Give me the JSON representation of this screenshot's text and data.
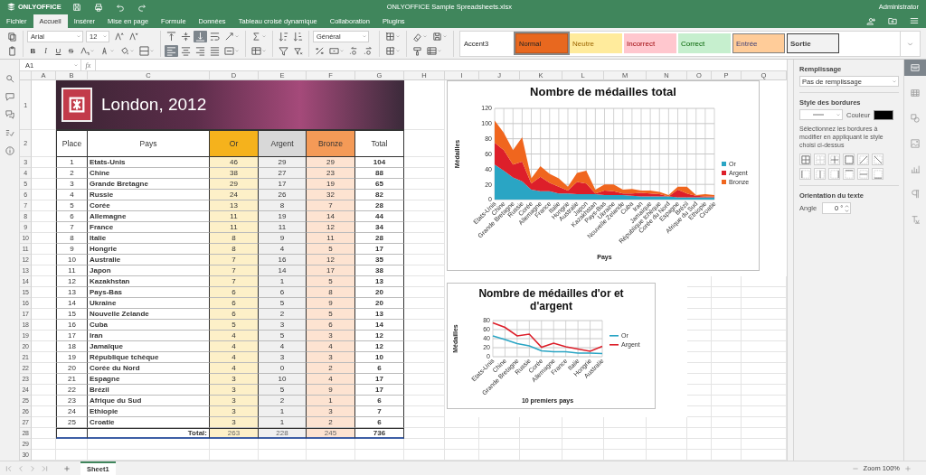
{
  "app": {
    "logo": "ONLYOFFICE",
    "title": "ONLYOFFICE Sample Spreadsheets.xlsx",
    "user": "Administrator"
  },
  "tabs": [
    {
      "label": "Fichier",
      "selected": false
    },
    {
      "label": "Accueil",
      "selected": true
    },
    {
      "label": "Insérer",
      "selected": false
    },
    {
      "label": "Mise en page",
      "selected": false
    },
    {
      "label": "Formule",
      "selected": false
    },
    {
      "label": "Données",
      "selected": false
    },
    {
      "label": "Tableau croisé dynamique",
      "selected": false
    },
    {
      "label": "Collaboration",
      "selected": false
    },
    {
      "label": "Plugins",
      "selected": false
    }
  ],
  "toolbar": {
    "font_name": "Arial",
    "font_size": "12",
    "style_buttons": [
      "B",
      "I",
      "U",
      "S"
    ],
    "number_format": "Général",
    "styles": [
      {
        "label": "Accent3",
        "kind": "accent",
        "selected": false
      },
      {
        "label": "Normal",
        "kind": "normal",
        "selected": true
      },
      {
        "label": "Neutre",
        "kind": "neutral",
        "selected": false
      },
      {
        "label": "Incorrect",
        "kind": "bad",
        "selected": false
      },
      {
        "label": "Correct",
        "kind": "good",
        "selected": false
      },
      {
        "label": "Entrée",
        "kind": "input",
        "selected": false
      },
      {
        "label": "Sortie",
        "kind": "output",
        "selected": false
      }
    ]
  },
  "formula_bar": {
    "cell_ref": "A1",
    "fx": "fx"
  },
  "sheet": {
    "columns": [
      "A",
      "B",
      "C",
      "D",
      "E",
      "F",
      "G",
      "H",
      "I",
      "J",
      "K",
      "L",
      "M",
      "N",
      "O",
      "P",
      "Q"
    ],
    "rows": [
      "1",
      "2",
      "3",
      "4",
      "5",
      "6",
      "7",
      "8",
      "9",
      "10",
      "11",
      "12",
      "13",
      "14",
      "15",
      "16",
      "17",
      "18",
      "19",
      "20",
      "21",
      "22",
      "23",
      "24",
      "25",
      "26",
      "27",
      "28",
      "29",
      "30"
    ],
    "banner_title": "London, 2012",
    "table": {
      "columns": [
        "Place",
        "Pays",
        "Or",
        "Argent",
        "Bronze",
        "Total"
      ],
      "rows": [
        [
          "1",
          "Etats-Unis",
          "46",
          "29",
          "29",
          "104"
        ],
        [
          "2",
          "Chine",
          "38",
          "27",
          "23",
          "88"
        ],
        [
          "3",
          "Grande Bretagne",
          "29",
          "17",
          "19",
          "65"
        ],
        [
          "4",
          "Russie",
          "24",
          "26",
          "32",
          "82"
        ],
        [
          "5",
          "Corée",
          "13",
          "8",
          "7",
          "28"
        ],
        [
          "6",
          "Allemagne",
          "11",
          "19",
          "14",
          "44"
        ],
        [
          "7",
          "France",
          "11",
          "11",
          "12",
          "34"
        ],
        [
          "8",
          "Italie",
          "8",
          "9",
          "11",
          "28"
        ],
        [
          "9",
          "Hongrie",
          "8",
          "4",
          "5",
          "17"
        ],
        [
          "10",
          "Australie",
          "7",
          "16",
          "12",
          "35"
        ],
        [
          "11",
          "Japon",
          "7",
          "14",
          "17",
          "38"
        ],
        [
          "12",
          "Kazakhstan",
          "7",
          "1",
          "5",
          "13"
        ],
        [
          "13",
          "Pays-Bas",
          "6",
          "6",
          "8",
          "20"
        ],
        [
          "14",
          "Ukraine",
          "6",
          "5",
          "9",
          "20"
        ],
        [
          "15",
          "Nouvelle Zelande",
          "6",
          "2",
          "5",
          "13"
        ],
        [
          "16",
          "Cuba",
          "5",
          "3",
          "6",
          "14"
        ],
        [
          "17",
          "Iran",
          "4",
          "5",
          "3",
          "12"
        ],
        [
          "18",
          "Jamaïque",
          "4",
          "4",
          "4",
          "12"
        ],
        [
          "19",
          "République tchèque",
          "4",
          "3",
          "3",
          "10"
        ],
        [
          "20",
          "Corée du Nord",
          "4",
          "0",
          "2",
          "6"
        ],
        [
          "21",
          "Espagne",
          "3",
          "10",
          "4",
          "17"
        ],
        [
          "22",
          "Brézil",
          "3",
          "5",
          "9",
          "17"
        ],
        [
          "23",
          "Afrique du Sud",
          "3",
          "2",
          "1",
          "6"
        ],
        [
          "24",
          "Ethiopie",
          "3",
          "1",
          "3",
          "7"
        ],
        [
          "25",
          "Croatie",
          "3",
          "1",
          "2",
          "6"
        ]
      ],
      "total_label": "Total:",
      "totals": [
        "263",
        "228",
        "245",
        "736"
      ]
    }
  },
  "charts": [
    {
      "chart_data": {
        "type": "area",
        "stacked": true,
        "title": "Nombre de médailles total",
        "xlabel": "Pays",
        "ylabel": "Médailles",
        "categories": [
          "Etats-Unis",
          "Chine",
          "Grande Bretagne",
          "Russie",
          "Corée",
          "Allemagne",
          "France",
          "Italie",
          "Hongrie",
          "Australie",
          "Japon",
          "Kazakhstan",
          "Pays-Bas",
          "Ukraine",
          "Nouvelle Zelande",
          "Cuba",
          "Iran",
          "Jamaïque",
          "République tchèque",
          "Corée du Nord",
          "Espagne",
          "Brézil",
          "Afrique du Sud",
          "Ethiopie",
          "Croatie"
        ],
        "series": [
          {
            "name": "Or",
            "color": "#2aa5c4",
            "values": [
              46,
              38,
              29,
              24,
              13,
              11,
              11,
              8,
              8,
              7,
              7,
              7,
              6,
              6,
              6,
              5,
              4,
              4,
              4,
              4,
              3,
              3,
              3,
              3,
              3
            ]
          },
          {
            "name": "Argent",
            "color": "#dd1f2a",
            "values": [
              29,
              27,
              17,
              26,
              8,
              19,
              11,
              9,
              4,
              16,
              14,
              1,
              6,
              5,
              2,
              3,
              5,
              4,
              3,
              0,
              10,
              5,
              2,
              1,
              1
            ]
          },
          {
            "name": "Bronze",
            "color": "#f0661e",
            "values": [
              29,
              23,
              19,
              32,
              7,
              14,
              12,
              11,
              5,
              12,
              17,
              5,
              8,
              9,
              5,
              6,
              3,
              4,
              3,
              2,
              4,
              9,
              1,
              3,
              2
            ]
          }
        ],
        "ylim": [
          0,
          120
        ],
        "yticks": [
          0,
          20,
          40,
          60,
          80,
          100,
          120
        ],
        "grid": true,
        "legend": true
      }
    },
    {
      "chart_data": {
        "type": "line",
        "stacked": false,
        "title": "Nombre de médailles d'or et d'argent",
        "xlabel": "10 premiers pays",
        "ylabel": "Médailles",
        "categories": [
          "Etats-Unis",
          "Chine",
          "Grande Bretagne",
          "Russie",
          "Corée",
          "Allemagne",
          "France",
          "Italie",
          "Hongrie",
          "Australie"
        ],
        "series": [
          {
            "name": "Or",
            "color": "#2aa5c4",
            "values": [
              46,
              38,
              29,
              24,
              13,
              11,
              11,
              8,
              8,
              7
            ]
          },
          {
            "name": "Argent",
            "color": "#dd1f2a",
            "values": [
              75,
              65,
              46,
              50,
              21,
              30,
              22,
              17,
              12,
              23
            ]
          }
        ],
        "ylim": [
          0,
          80
        ],
        "yticks": [
          0,
          20,
          40,
          60,
          80
        ],
        "grid": true,
        "legend": true
      }
    }
  ],
  "format_panel": {
    "fill_label": "Remplissage",
    "fill_value": "Pas de remplissage",
    "border_label": "Style des bordures",
    "color_label": "Couleur",
    "border_hint": "Sélectionnez les bordures à modifier en appliquant le style choisi ci-dessus",
    "orientation_label": "Orientation du texte",
    "angle_label": "Angle",
    "angle_value": "0 °"
  },
  "sheet_tabs": [
    {
      "label": "Sheet1",
      "selected": true
    }
  ],
  "zoom": "Zoom 100%"
}
